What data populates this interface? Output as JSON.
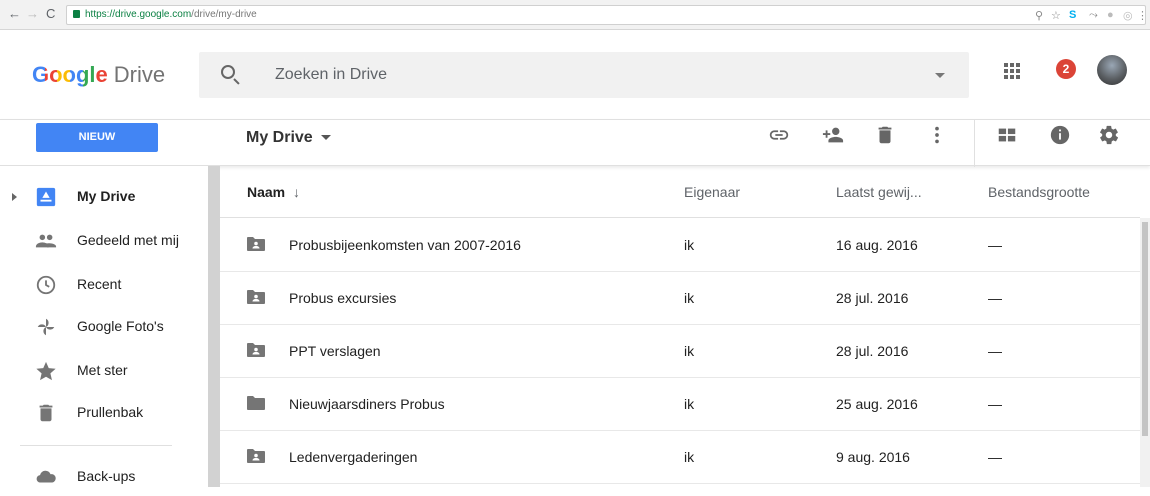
{
  "browser": {
    "url_host": "https://drive.google.com",
    "url_path": "/drive/my-drive"
  },
  "header": {
    "logo_google": "Google",
    "logo_drive": "Drive",
    "search_placeholder": "Zoeken in Drive",
    "notification_count": "2"
  },
  "toolbar": {
    "new_label": "NIEUW",
    "breadcrumb": "My Drive"
  },
  "sidebar": {
    "items": [
      {
        "label": "My Drive",
        "icon": "drive-icon"
      },
      {
        "label": "Gedeeld met mij",
        "icon": "shared-people-icon"
      },
      {
        "label": "Recent",
        "icon": "clock-icon"
      },
      {
        "label": "Google Foto's",
        "icon": "photos-pinwheel-icon"
      },
      {
        "label": "Met ster",
        "icon": "star-icon"
      },
      {
        "label": "Prullenbak",
        "icon": "trash-icon"
      },
      {
        "label": "Back-ups",
        "icon": "cloud-icon"
      }
    ]
  },
  "list": {
    "columns": {
      "name": "Naam",
      "owner": "Eigenaar",
      "modified": "Laatst gewij...",
      "size": "Bestandsgrootte"
    },
    "rows": [
      {
        "name": "Probusbijeenkomsten van 2007-2016",
        "owner": "ik",
        "modified": "16 aug. 2016",
        "size": "—",
        "icon": "shared-folder-icon"
      },
      {
        "name": "Probus excursies",
        "owner": "ik",
        "modified": "28 jul. 2016",
        "size": "—",
        "icon": "shared-folder-icon"
      },
      {
        "name": "PPT verslagen",
        "owner": "ik",
        "modified": "28 jul. 2016",
        "size": "—",
        "icon": "shared-folder-icon"
      },
      {
        "name": "Nieuwjaarsdiners Probus",
        "owner": "ik",
        "modified": "25 aug. 2016",
        "size": "—",
        "icon": "folder-icon"
      },
      {
        "name": "Ledenvergaderingen",
        "owner": "ik",
        "modified": "9 aug. 2016",
        "size": "—",
        "icon": "shared-folder-icon"
      }
    ]
  },
  "colors": {
    "accent": "#4285f4",
    "badge": "#db4437",
    "icon_gray": "#757575"
  }
}
